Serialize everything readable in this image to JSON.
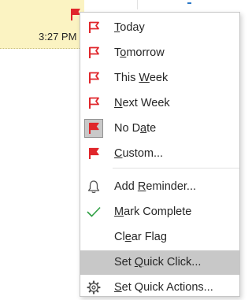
{
  "message_row": {
    "time": "3:27 PM",
    "flag_color": "#e0262b",
    "highlight_color": "#fbf3c2"
  },
  "menu": {
    "items": [
      {
        "pre": "",
        "key": "T",
        "post": "oday",
        "icon": "red-flag-icon"
      },
      {
        "pre": "T",
        "key": "o",
        "post": "morrow",
        "icon": "red-flag-icon"
      },
      {
        "pre": "This ",
        "key": "W",
        "post": "eek",
        "icon": "red-flag-icon"
      },
      {
        "pre": "",
        "key": "N",
        "post": "ext Week",
        "icon": "red-flag-icon"
      },
      {
        "pre": "No D",
        "key": "a",
        "post": "te",
        "icon": "red-flag-icon",
        "highlighted": true
      },
      {
        "pre": "",
        "key": "C",
        "post": "ustom...",
        "icon": "red-flag-icon"
      },
      {
        "pre": "Add ",
        "key": "R",
        "post": "eminder...",
        "icon": "bell-icon"
      },
      {
        "pre": "",
        "key": "M",
        "post": "ark Complete",
        "icon": "checkmark-icon"
      },
      {
        "pre": "Cl",
        "key": "e",
        "post": "ar Flag",
        "icon": ""
      },
      {
        "pre": "Set ",
        "key": "Q",
        "post": "uick Click...",
        "icon": "",
        "selected": true
      },
      {
        "pre": "",
        "key": "S",
        "post": "et Quick Actions...",
        "icon": "gear-icon"
      }
    ]
  },
  "colors": {
    "flag_red": "#e0262b",
    "check_green": "#2ea043",
    "icon_gray": "#505050",
    "selected_bg": "#c8c8c8"
  }
}
